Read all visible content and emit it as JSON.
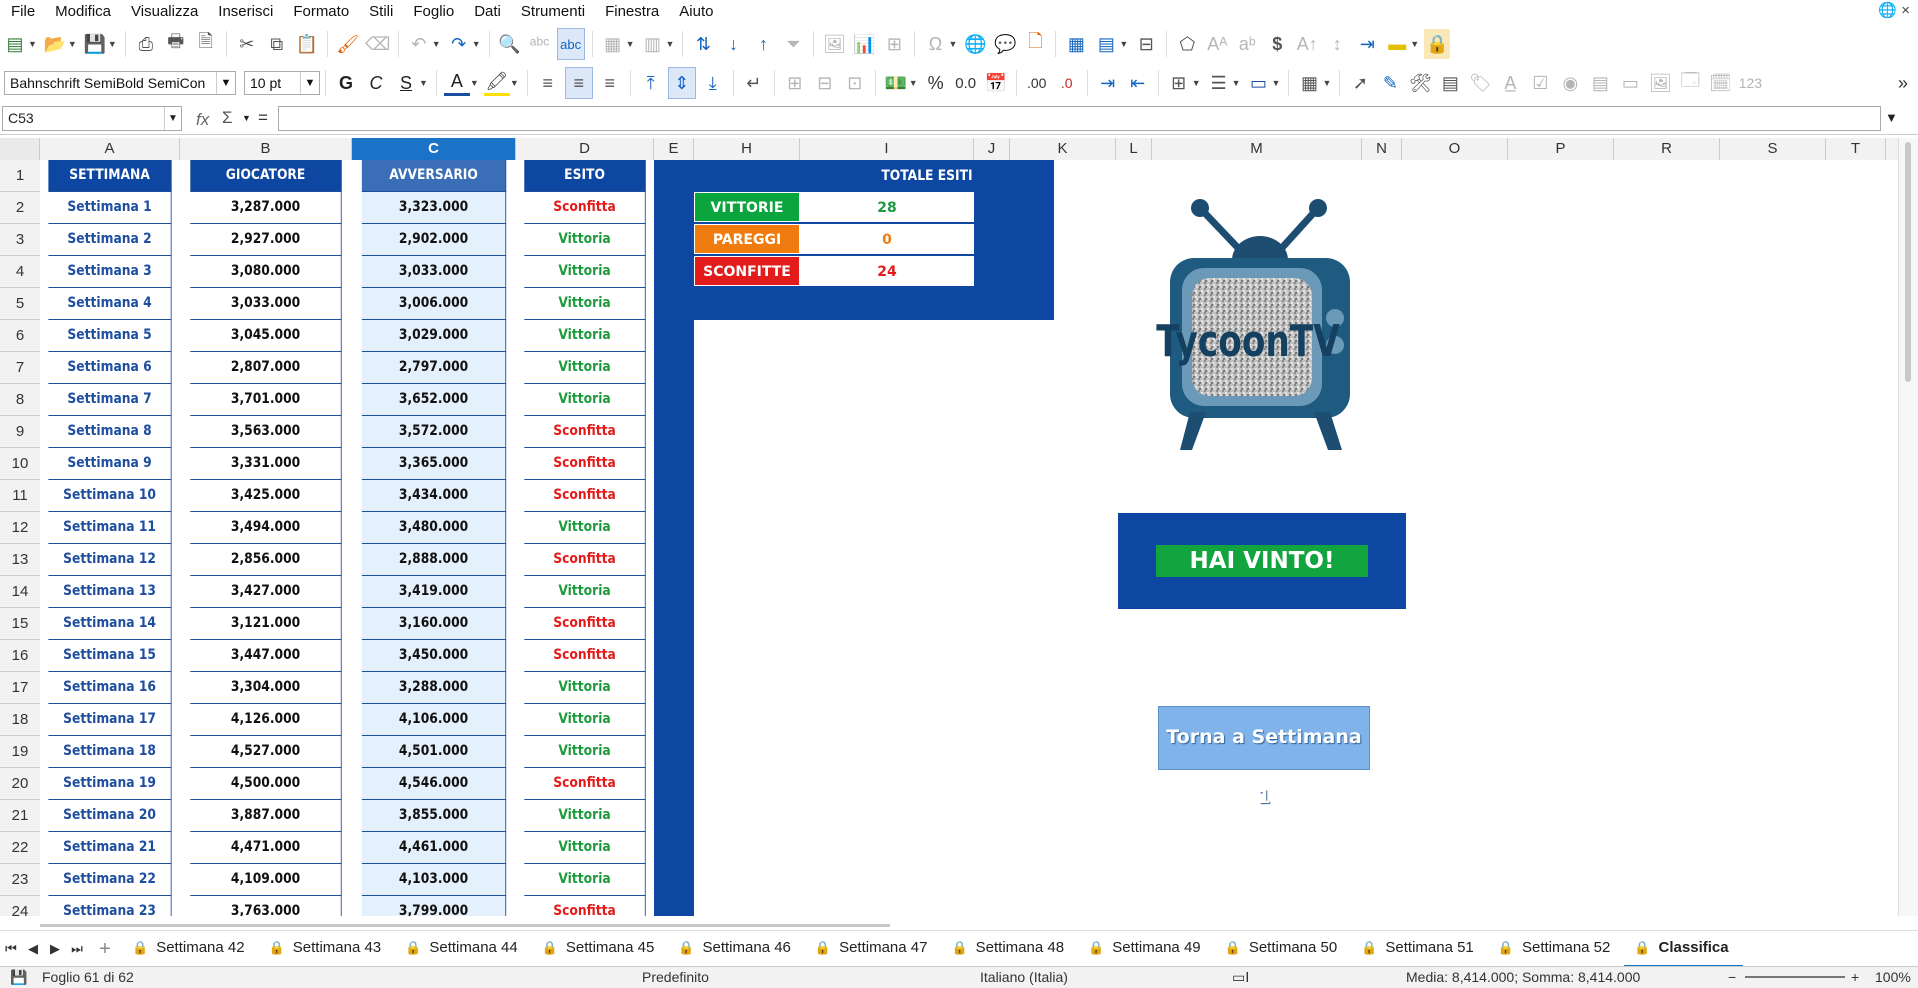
{
  "menu": [
    "File",
    "Modifica",
    "Visualizza",
    "Inserisci",
    "Formato",
    "Stili",
    "Foglio",
    "Dati",
    "Strumenti",
    "Finestra",
    "Aiuto"
  ],
  "toolbar": {
    "font_name": "Bahnschrift SemiBold SemiCon",
    "font_size": "10 pt",
    "bold": "G",
    "italic": "C",
    "underline": "S",
    "percent": "%",
    "decimal": "0.0",
    "add_decimal": ".00",
    "del_decimal": ".0",
    "currency": "$",
    "number_123": "123"
  },
  "formula_bar": {
    "cell_ref": "C53",
    "fx": "fx",
    "sigma": "Σ",
    "equals": "=",
    "content": ""
  },
  "columns": [
    {
      "label": "A",
      "w": 140
    },
    {
      "label": "B",
      "w": 172
    },
    {
      "label": "C",
      "w": 164
    },
    {
      "label": "D",
      "w": 138
    },
    {
      "label": "E",
      "w": 40
    },
    {
      "label": "H",
      "w": 106
    },
    {
      "label": "I",
      "w": 174
    },
    {
      "label": "J",
      "w": 36
    },
    {
      "label": "K",
      "w": 106
    },
    {
      "label": "L",
      "w": 36
    },
    {
      "label": "M",
      "w": 210
    },
    {
      "label": "N",
      "w": 40
    },
    {
      "label": "O",
      "w": 106
    },
    {
      "label": "P",
      "w": 106
    },
    {
      "label": "R",
      "w": 106
    },
    {
      "label": "S",
      "w": 106
    },
    {
      "label": "T",
      "w": 60
    }
  ],
  "selected_column": "C",
  "row_numbers": [
    "1",
    "2",
    "3",
    "4",
    "5",
    "6",
    "7",
    "8",
    "9",
    "10",
    "11",
    "12",
    "13",
    "14",
    "15",
    "16",
    "17",
    "18",
    "19",
    "20",
    "21",
    "22",
    "23",
    "24"
  ],
  "table": {
    "headers": [
      "SETTIMANA",
      "GIOCATORE",
      "AVVERSARIO",
      "ESITO"
    ],
    "rows": [
      [
        "Settimana 1",
        "3,287.000",
        "3,323.000",
        "Sconfitta"
      ],
      [
        "Settimana 2",
        "2,927.000",
        "2,902.000",
        "Vittoria"
      ],
      [
        "Settimana 3",
        "3,080.000",
        "3,033.000",
        "Vittoria"
      ],
      [
        "Settimana 4",
        "3,033.000",
        "3,006.000",
        "Vittoria"
      ],
      [
        "Settimana 5",
        "3,045.000",
        "3,029.000",
        "Vittoria"
      ],
      [
        "Settimana 6",
        "2,807.000",
        "2,797.000",
        "Vittoria"
      ],
      [
        "Settimana 7",
        "3,701.000",
        "3,652.000",
        "Vittoria"
      ],
      [
        "Settimana 8",
        "3,563.000",
        "3,572.000",
        "Sconfitta"
      ],
      [
        "Settimana 9",
        "3,331.000",
        "3,365.000",
        "Sconfitta"
      ],
      [
        "Settimana 10",
        "3,425.000",
        "3,434.000",
        "Sconfitta"
      ],
      [
        "Settimana 11",
        "3,494.000",
        "3,480.000",
        "Vittoria"
      ],
      [
        "Settimana 12",
        "2,856.000",
        "2,888.000",
        "Sconfitta"
      ],
      [
        "Settimana 13",
        "3,427.000",
        "3,419.000",
        "Vittoria"
      ],
      [
        "Settimana 14",
        "3,121.000",
        "3,160.000",
        "Sconfitta"
      ],
      [
        "Settimana 15",
        "3,447.000",
        "3,450.000",
        "Sconfitta"
      ],
      [
        "Settimana 16",
        "3,304.000",
        "3,288.000",
        "Vittoria"
      ],
      [
        "Settimana 17",
        "4,126.000",
        "4,106.000",
        "Vittoria"
      ],
      [
        "Settimana 18",
        "4,527.000",
        "4,501.000",
        "Vittoria"
      ],
      [
        "Settimana 19",
        "4,500.000",
        "4,546.000",
        "Sconfitta"
      ],
      [
        "Settimana 20",
        "3,887.000",
        "3,855.000",
        "Vittoria"
      ],
      [
        "Settimana 21",
        "4,471.000",
        "4,461.000",
        "Vittoria"
      ],
      [
        "Settimana 22",
        "4,109.000",
        "4,103.000",
        "Vittoria"
      ],
      [
        "Settimana 23",
        "3,763.000",
        "3,799.000",
        "Sconfitta"
      ]
    ]
  },
  "totals": {
    "header": "TOTALE ESITI",
    "items": [
      {
        "label": "VITTORIE",
        "value": "28",
        "color": "#0aa63d",
        "text": "#1e9a3e"
      },
      {
        "label": "PAREGGI",
        "value": "0",
        "color": "#f07c10",
        "text": "#f07c10"
      },
      {
        "label": "SCONFITTE",
        "value": "24",
        "color": "#e31b1b",
        "text": "#e31b1b"
      }
    ]
  },
  "logo_text": "TycoonTV",
  "result_banner": "HAI VINTO!",
  "back_button": "Torna a Settimana 1",
  "sheet_tabs": [
    "Settimana 42",
    "Settimana 43",
    "Settimana 44",
    "Settimana 45",
    "Settimana 46",
    "Settimana 47",
    "Settimana 48",
    "Settimana 49",
    "Settimana 50",
    "Settimana 51",
    "Settimana 52",
    "Classifica"
  ],
  "active_tab": "Classifica",
  "status": {
    "sheet": "Foglio 61 di 62",
    "style": "Predefinito",
    "language": "Italiano (Italia)",
    "summary": "Media: 8,414.000; Somma: 8,414.000",
    "zoom": "100%"
  },
  "colors": {
    "header_blue": "#0e47a1",
    "win": "#1e9a3e",
    "loss": "#e31b1b",
    "selection": "#1a73c7"
  }
}
